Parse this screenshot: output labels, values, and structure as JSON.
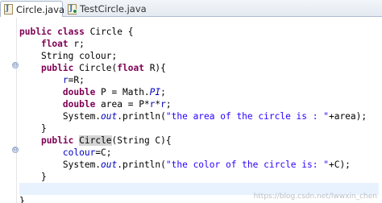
{
  "tabs": [
    {
      "label": "Circle.java",
      "active": true,
      "close_glyph": "✕"
    },
    {
      "label": "TestCircle.java",
      "active": false
    }
  ],
  "code": {
    "l1": {
      "kw1": "public",
      "s1": " ",
      "kw2": "class",
      "rest": " Circle {"
    },
    "l2": {
      "kw": "float",
      "rest": " r;"
    },
    "l3": {
      "rest": "String colour;"
    },
    "l4": {
      "kw": "public",
      "rest": " Circle(",
      "kw2": "float",
      "rest2": " R){"
    },
    "l5": {
      "fld": "r",
      "rest": "=R;"
    },
    "l6": {
      "kw": "double",
      "rest": " P = Math.",
      "st": "PI",
      "rest2": ";"
    },
    "l7": {
      "kw": "double",
      "rest": " area = P*",
      "fld1": "r",
      "mid": "*",
      "fld2": "r",
      "rest2": ";"
    },
    "l8": {
      "pre": "System.",
      "st": "out",
      "mid": ".println(",
      "str": "\"the area of the circle is : \"",
      "rest": "+area);"
    },
    "l9": {
      "rest": "}"
    },
    "l10": {
      "kw": "public",
      "s": " ",
      "occ": "Circle",
      "rest": "(String C){"
    },
    "l11": {
      "fld": "colour",
      "rest": "=C;"
    },
    "l12": {
      "pre": "System.",
      "st": "out",
      "mid": ".println(",
      "str": "\"the color of the circle is: \"",
      "rest": "+C);"
    },
    "l13": {
      "rest": "}"
    },
    "l15": {
      "rest": "}"
    }
  },
  "fold_glyph": "⊖",
  "watermark": "https://blog.csdn.net/lwwxin_chen"
}
